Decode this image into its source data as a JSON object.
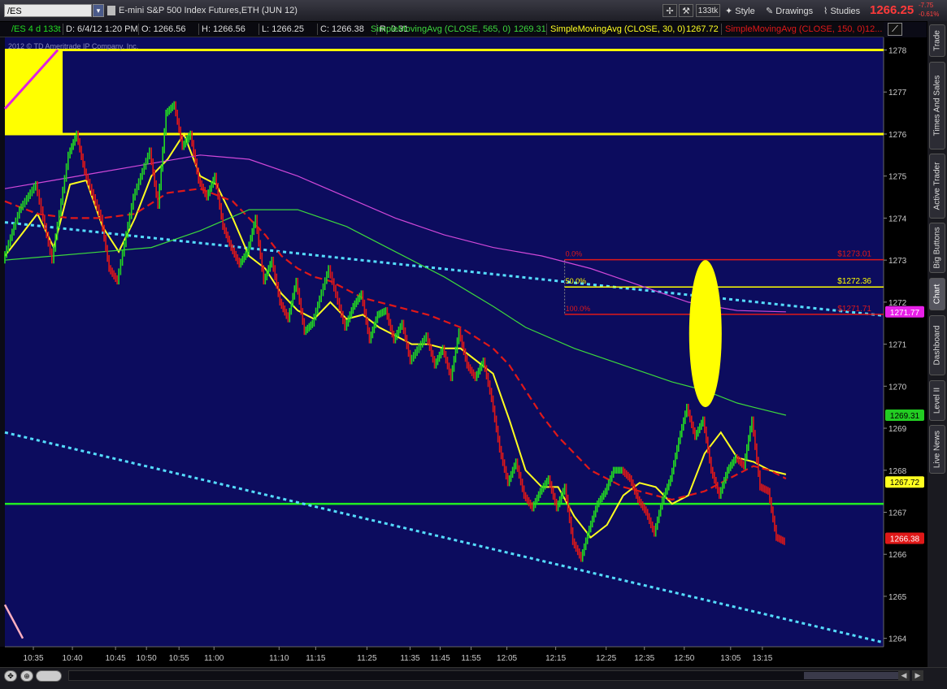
{
  "toolbar": {
    "symbol": "/ES",
    "title": "E-mini S&P 500 Index Futures,ETH (JUN 12)",
    "aggregation": "133tk",
    "style_label": "Style",
    "drawings_label": "Drawings",
    "studies_label": "Studies",
    "last_price": "1266.25",
    "change_abs": "-7.75",
    "change_pct": "-0.61%"
  },
  "infobar": {
    "period": "/ES 4 d 133t",
    "date": "D: 6/4/12 1:20 PM",
    "open": "O: 1266.56",
    "high": "H: 1266.56",
    "low": "L: 1266.25",
    "close": "C: 1266.38",
    "range": "R: 0.31",
    "sma1_label": "SimpleMovingAvg (CLOSE, 565, 0)",
    "sma1_value": "1269.31",
    "sma2_label": "SimpleMovingAvg (CLOSE, 30, 0)",
    "sma2_value": "1267.72",
    "sma3_label": "SimpleMovingAvg (CLOSE, 150, 0)",
    "sma3_value": "12..."
  },
  "copyright": "2012 © TD Ameritrade IP Company, Inc.",
  "sidebar": {
    "tabs": [
      {
        "label": "Trade"
      },
      {
        "label": "Times And Sales"
      },
      {
        "label": "Active Trader"
      },
      {
        "label": "Big Buttons"
      },
      {
        "label": "Chart"
      },
      {
        "label": "Dashboard"
      },
      {
        "label": "Level II"
      },
      {
        "label": "Live News"
      }
    ]
  },
  "colors": {
    "background": "#0c0c5e",
    "up_candle": "#22d822",
    "down_candle": "#e01818",
    "sma30": "#ffff20",
    "sma150": "#e01818",
    "sma565": "#3cd83c",
    "sma_long": "#d048d8",
    "resistance": "#ffff00",
    "support": "#22ee22",
    "trendline": "#55ddff",
    "fib_line": "#e01818",
    "fib_mid": "#ffff00",
    "highlight": "#ffff00"
  },
  "chart_data": {
    "type": "line",
    "ylim": [
      1263.8,
      1278.3
    ],
    "yticks": [
      1264,
      1265,
      1266,
      1267,
      1268,
      1269,
      1270,
      1271,
      1272,
      1273,
      1274,
      1275,
      1276,
      1277,
      1278
    ],
    "xlim": [
      0,
      108
    ],
    "xticks": [
      {
        "x": 3.5,
        "label": "10:35"
      },
      {
        "x": 8.3,
        "label": "10:40"
      },
      {
        "x": 13.6,
        "label": "10:45"
      },
      {
        "x": 17.4,
        "label": "10:50"
      },
      {
        "x": 21.4,
        "label": "10:55"
      },
      {
        "x": 25.7,
        "label": "11:00"
      },
      {
        "x": 33.7,
        "label": "11:10"
      },
      {
        "x": 38.2,
        "label": "11:15"
      },
      {
        "x": 44.5,
        "label": "11:25"
      },
      {
        "x": 49.8,
        "label": "11:35"
      },
      {
        "x": 53.5,
        "label": "11:45"
      },
      {
        "x": 57.3,
        "label": "11:55"
      },
      {
        "x": 61.7,
        "label": "12:05"
      },
      {
        "x": 67.7,
        "label": "12:15"
      },
      {
        "x": 73.9,
        "label": "12:25"
      },
      {
        "x": 78.6,
        "label": "12:35"
      },
      {
        "x": 83.5,
        "label": "12:50"
      },
      {
        "x": 89.2,
        "label": "13:05"
      },
      {
        "x": 93.1,
        "label": "13:15"
      }
    ],
    "price_series": {
      "name": "/ES",
      "x": [
        0,
        2,
        4,
        6,
        8,
        9,
        10,
        12,
        13,
        14,
        16,
        18,
        19,
        20,
        21,
        22,
        23,
        24,
        25,
        26,
        27,
        28,
        29,
        30,
        31,
        32,
        33,
        34,
        35,
        36,
        37,
        38,
        40,
        42,
        43,
        44,
        45,
        46,
        47,
        48,
        49,
        50,
        52,
        53,
        54,
        55,
        56,
        57,
        58,
        59,
        60,
        61,
        62,
        63,
        64,
        65,
        66,
        67,
        68,
        69,
        70,
        71,
        72,
        73,
        74,
        75,
        76,
        77,
        78,
        79,
        80,
        81,
        82,
        83,
        84,
        85,
        86,
        87,
        88,
        89,
        90,
        91,
        92,
        93,
        94,
        95,
        96
      ],
      "y": [
        1273.0,
        1274.2,
        1274.8,
        1273.0,
        1275.5,
        1276.0,
        1275.1,
        1274.0,
        1272.8,
        1272.5,
        1274.5,
        1275.6,
        1274.3,
        1276.5,
        1276.7,
        1275.7,
        1276.0,
        1274.9,
        1274.5,
        1275.0,
        1273.8,
        1273.3,
        1272.9,
        1273.2,
        1274.0,
        1272.5,
        1273.0,
        1272.0,
        1271.6,
        1272.5,
        1271.3,
        1271.5,
        1272.8,
        1271.4,
        1271.9,
        1272.2,
        1271.1,
        1271.7,
        1271.8,
        1271.1,
        1271.5,
        1270.6,
        1271.2,
        1270.5,
        1270.9,
        1270.2,
        1271.3,
        1270.5,
        1270.2,
        1270.6,
        1269.7,
        1268.5,
        1267.7,
        1268.2,
        1267.4,
        1267.1,
        1267.5,
        1267.8,
        1267.1,
        1267.6,
        1266.3,
        1265.9,
        1266.6,
        1267.2,
        1267.5,
        1268.0,
        1268.0,
        1267.8,
        1267.3,
        1267.0,
        1266.5,
        1267.3,
        1267.8,
        1268.7,
        1269.5,
        1268.8,
        1269.2,
        1268.0,
        1267.4,
        1268.0,
        1268.3,
        1268.1,
        1269.2,
        1267.6,
        1267.5,
        1266.4,
        1266.3
      ]
    },
    "series": [
      {
        "name": "SimpleMovingAvg (CLOSE, 30, 0)",
        "x": [
          0,
          2,
          4,
          6,
          8,
          10,
          12,
          14,
          16,
          18,
          20,
          22,
          24,
          26,
          28,
          30,
          32,
          34,
          36,
          38,
          40,
          42,
          44,
          46,
          48,
          50,
          52,
          54,
          56,
          58,
          60,
          62,
          64,
          66,
          68,
          70,
          72,
          74,
          76,
          78,
          80,
          82,
          84,
          86,
          88,
          90,
          92,
          94,
          96
        ],
        "y": [
          1273.1,
          1273.6,
          1274.1,
          1273.3,
          1274.8,
          1274.9,
          1273.8,
          1273.2,
          1274.0,
          1275.0,
          1275.4,
          1276.0,
          1275.0,
          1274.8,
          1274.0,
          1273.1,
          1272.8,
          1272.2,
          1271.8,
          1271.6,
          1272.0,
          1271.6,
          1271.7,
          1271.4,
          1271.2,
          1271.0,
          1271.0,
          1270.9,
          1270.9,
          1270.6,
          1270.3,
          1269.2,
          1268.0,
          1267.6,
          1267.6,
          1266.9,
          1266.4,
          1266.7,
          1267.4,
          1267.7,
          1267.6,
          1267.2,
          1267.4,
          1268.4,
          1268.9,
          1268.3,
          1268.2,
          1268.0,
          1267.9
        ]
      },
      {
        "name": "SimpleMovingAvg (CLOSE, 150, 0)",
        "x": [
          0,
          4,
          8,
          12,
          16,
          20,
          24,
          28,
          30,
          32,
          34,
          36,
          38,
          40,
          44,
          48,
          52,
          56,
          60,
          62,
          64,
          66,
          68,
          70,
          72,
          74,
          76,
          78,
          80,
          82,
          84,
          86,
          88,
          90,
          92,
          94,
          96
        ],
        "y": [
          1274.4,
          1274.1,
          1274.0,
          1274.0,
          1274.1,
          1274.6,
          1274.7,
          1274.4,
          1274.0,
          1273.6,
          1273.1,
          1272.8,
          1272.6,
          1272.5,
          1272.1,
          1271.9,
          1271.7,
          1271.4,
          1270.9,
          1270.5,
          1269.9,
          1269.3,
          1268.8,
          1268.4,
          1268.0,
          1267.8,
          1267.6,
          1267.5,
          1267.4,
          1267.3,
          1267.4,
          1267.5,
          1267.7,
          1267.9,
          1268.1,
          1268.0,
          1267.8
        ]
      },
      {
        "name": "SimpleMovingAvg (CLOSE, 565, 0)",
        "x": [
          0,
          6,
          12,
          18,
          24,
          30,
          36,
          42,
          48,
          54,
          60,
          64,
          70,
          76,
          82,
          86,
          90,
          92,
          96
        ],
        "y": [
          1273.0,
          1273.1,
          1273.2,
          1273.3,
          1273.7,
          1274.2,
          1274.2,
          1273.8,
          1273.2,
          1272.6,
          1271.9,
          1271.4,
          1270.9,
          1270.5,
          1270.1,
          1269.9,
          1269.6,
          1269.5,
          1269.31
        ]
      },
      {
        "name": "SimpleMovingAvg",
        "x": [
          0,
          6,
          12,
          18,
          24,
          30,
          36,
          42,
          48,
          54,
          60,
          66,
          72,
          78,
          84,
          90,
          96
        ],
        "y": [
          1274.7,
          1274.9,
          1275.1,
          1275.3,
          1275.5,
          1275.4,
          1275.0,
          1274.5,
          1274.0,
          1273.6,
          1273.3,
          1273.1,
          1272.8,
          1272.4,
          1272.0,
          1271.8,
          1271.77
        ]
      }
    ],
    "price_labels": [
      {
        "value": 1271.77,
        "label": "1271.77",
        "color": "#e820e8"
      },
      {
        "value": 1269.31,
        "label": "1269.31",
        "color": "#22cc22"
      },
      {
        "value": 1267.72,
        "label": "1267.72",
        "color": "#ffff20"
      },
      {
        "value": 1266.38,
        "label": "1266.38",
        "color": "#e01818"
      }
    ],
    "annotations": {
      "resistance_box": {
        "x0": 0,
        "x1": 7.1,
        "y0": 1276.0,
        "y1": 1278.0
      },
      "resistance_lines": [
        1276.0,
        1278.0
      ],
      "support_line": 1267.2,
      "trendlines": [
        {
          "x0": 0,
          "y0": 1273.9,
          "x1": 108,
          "y1": 1271.68
        },
        {
          "x0": 0,
          "y0": 1268.9,
          "x1": 108,
          "y1": 1263.9
        }
      ],
      "upper_left_line": {
        "x0": 0,
        "y0": 1276.6,
        "x1": 6.5,
        "y1": 1278.0
      },
      "lower_left_line": {
        "x0": 0,
        "y0": 1264.8,
        "x1": 2.2,
        "y1": 1264.0
      },
      "fibonacci": {
        "x0": 68.8,
        "x1": 108,
        "levels": [
          {
            "pct": "0.0%",
            "value": 1273.01,
            "label": "$1273.01",
            "color": "#e01818"
          },
          {
            "pct": "50.0%",
            "value": 1272.36,
            "label": "$1272.36",
            "color": "#ffff00"
          },
          {
            "pct": "100.0%",
            "value": 1271.71,
            "label": "$1271.71",
            "color": "#e01818"
          }
        ]
      },
      "highlight_ellipse": {
        "cx": 86.1,
        "cy": 1271.25,
        "rx": 2.0,
        "ry": 1.75
      }
    }
  }
}
